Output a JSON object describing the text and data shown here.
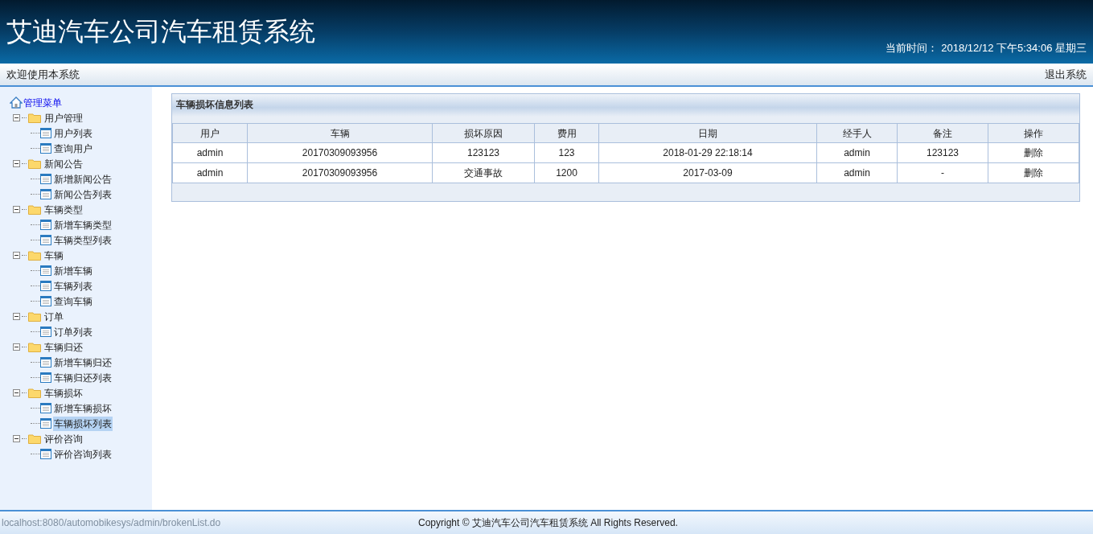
{
  "header": {
    "title": "艾迪汽车公司汽车租赁系统",
    "time_label": "当前时间：",
    "time_value": "2018/12/12 下午5:34:06 星期三"
  },
  "topbar": {
    "welcome": "欢迎使用本系统",
    "logout": "退出系统"
  },
  "sidebar": {
    "root": "管理菜单",
    "items": [
      {
        "label": "用户管理",
        "expanded": true,
        "children": [
          {
            "label": "用户列表",
            "selected": false
          },
          {
            "label": "查询用户",
            "selected": false
          }
        ]
      },
      {
        "label": "新闻公告",
        "expanded": true,
        "children": [
          {
            "label": "新增新闻公告",
            "selected": false
          },
          {
            "label": "新闻公告列表",
            "selected": false
          }
        ]
      },
      {
        "label": "车辆类型",
        "expanded": true,
        "children": [
          {
            "label": "新增车辆类型",
            "selected": false
          },
          {
            "label": "车辆类型列表",
            "selected": false
          }
        ]
      },
      {
        "label": "车辆",
        "expanded": true,
        "children": [
          {
            "label": "新增车辆",
            "selected": false
          },
          {
            "label": "车辆列表",
            "selected": false
          },
          {
            "label": "查询车辆",
            "selected": false
          }
        ]
      },
      {
        "label": "订单",
        "expanded": true,
        "children": [
          {
            "label": "订单列表",
            "selected": false
          }
        ]
      },
      {
        "label": "车辆归还",
        "expanded": true,
        "children": [
          {
            "label": "新增车辆归还",
            "selected": false
          },
          {
            "label": "车辆归还列表",
            "selected": false
          }
        ]
      },
      {
        "label": "车辆损坏",
        "expanded": true,
        "children": [
          {
            "label": "新增车辆损坏",
            "selected": false
          },
          {
            "label": "车辆损坏列表",
            "selected": true
          }
        ]
      },
      {
        "label": "评价咨询",
        "expanded": true,
        "children": [
          {
            "label": "评价咨询列表",
            "selected": false
          }
        ]
      }
    ]
  },
  "panel": {
    "title": "车辆损坏信息列表",
    "table": {
      "columns": [
        "用户",
        "车辆",
        "损坏原因",
        "费用",
        "日期",
        "经手人",
        "备注",
        "操作"
      ],
      "rows": [
        [
          "admin",
          "20170309093956",
          "123123",
          "123",
          "2018-01-29 22:18:14",
          "admin",
          "123123",
          "删除"
        ],
        [
          "admin",
          "20170309093956",
          "交通事故",
          "1200",
          "2017-03-09",
          "admin",
          "-",
          "删除"
        ]
      ]
    }
  },
  "footer": {
    "status_url": "localhost:8080/automobikesys/admin/brokenList.do",
    "copyright": "Copyright © 艾迪汽车公司汽车租赁系统 All Rights Reserved."
  }
}
